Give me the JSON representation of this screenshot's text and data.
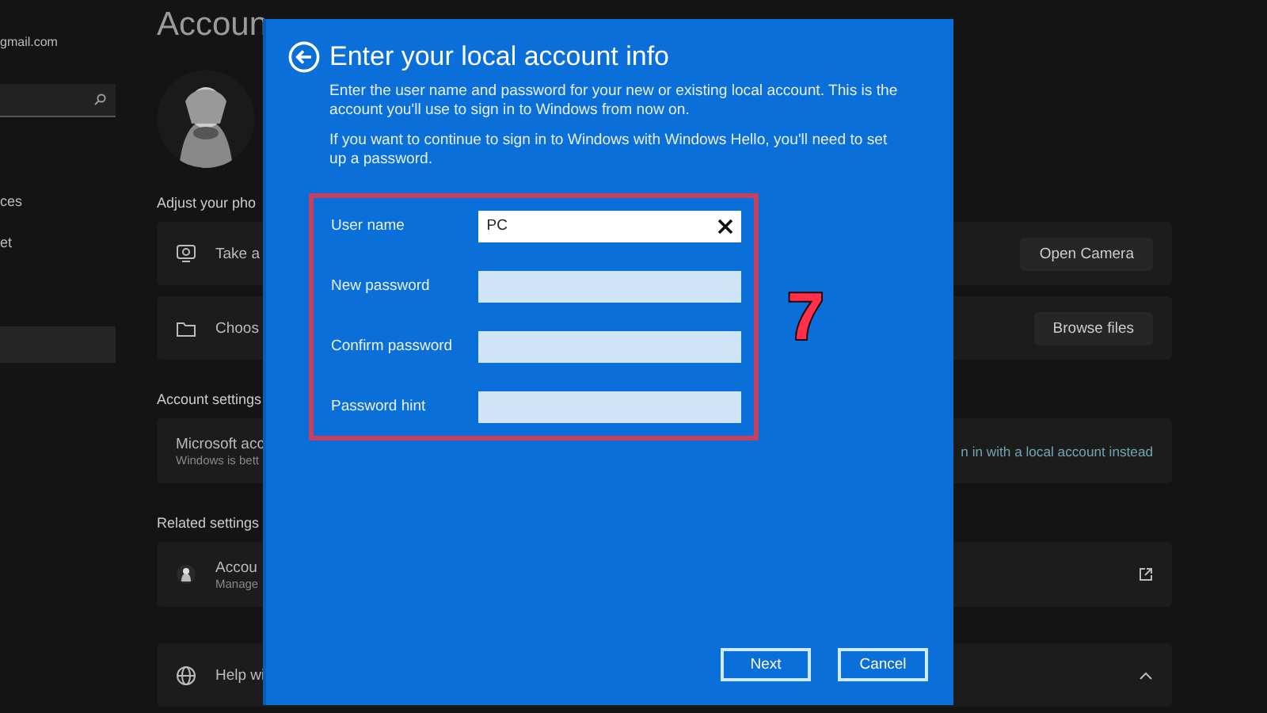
{
  "sidebar": {
    "account_email": "gmail.com",
    "items": [
      {
        "label": "ces"
      },
      {
        "label": "et"
      }
    ]
  },
  "main": {
    "title": "Accoun",
    "sections": [
      {
        "heading": "Adjust your pho",
        "cards": [
          {
            "kind": "button",
            "title": "Take a",
            "button": "Open Camera"
          },
          {
            "kind": "button",
            "title": "Choos",
            "button": "Browse files"
          }
        ]
      },
      {
        "heading": "Account settings",
        "cards": [
          {
            "kind": "link",
            "title": "Microsoft acc",
            "subtitle": "Windows is bett",
            "link": "n in with a local account instead"
          }
        ]
      },
      {
        "heading": "Related settings",
        "cards": [
          {
            "kind": "external",
            "title": "Accou",
            "subtitle": "Manage"
          }
        ]
      },
      {
        "cards": [
          {
            "kind": "expander",
            "title": "Help wi"
          }
        ]
      }
    ]
  },
  "dialog": {
    "title": "Enter your local account info",
    "paragraphs": [
      "Enter the user name and password for your new or existing local account. This is the account you'll use to sign in to Windows from now on.",
      "If you want to continue to sign in to Windows with Windows Hello, you'll need to set up a password."
    ],
    "fields": [
      {
        "label": "User name",
        "value": "PC",
        "focused": true
      },
      {
        "label": "New password",
        "focused": false
      },
      {
        "label": "Confirm password",
        "focused": false
      },
      {
        "label": "Password hint",
        "focused": false
      }
    ],
    "annotation": {
      "step": "7"
    },
    "buttons": [
      "Next",
      "Cancel"
    ]
  }
}
